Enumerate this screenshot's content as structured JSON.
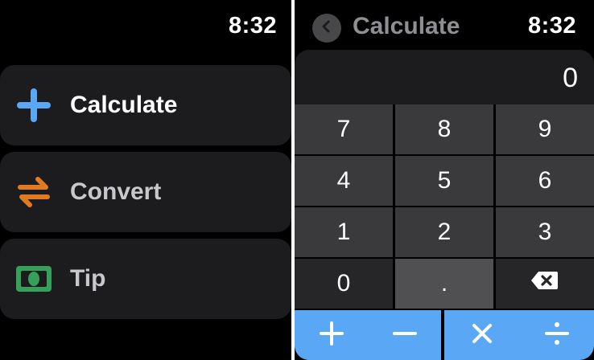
{
  "menu_screen": {
    "time": "8:32",
    "items": [
      {
        "label": "Calculate",
        "icon": "plus-icon",
        "color": "#5aa7f5",
        "label_color": "#ffffff"
      },
      {
        "label": "Convert",
        "icon": "swap-arrows-icon",
        "color": "#e07b22",
        "label_color": "#c7c7cc"
      },
      {
        "label": "Tip",
        "icon": "cash-bill-icon",
        "color": "#35a05a",
        "label_color": "#c7c7cc"
      }
    ]
  },
  "calc_screen": {
    "time": "8:32",
    "title": "Calculate",
    "back_icon": "chevron-left-icon",
    "display_value": "0",
    "keys": [
      "7",
      "8",
      "9",
      "4",
      "5",
      "6",
      "1",
      "2",
      "3",
      "0",
      ".",
      "⌫"
    ],
    "operators": [
      "+",
      "−",
      "×",
      "÷"
    ],
    "accent_color": "#5aa7f5"
  }
}
